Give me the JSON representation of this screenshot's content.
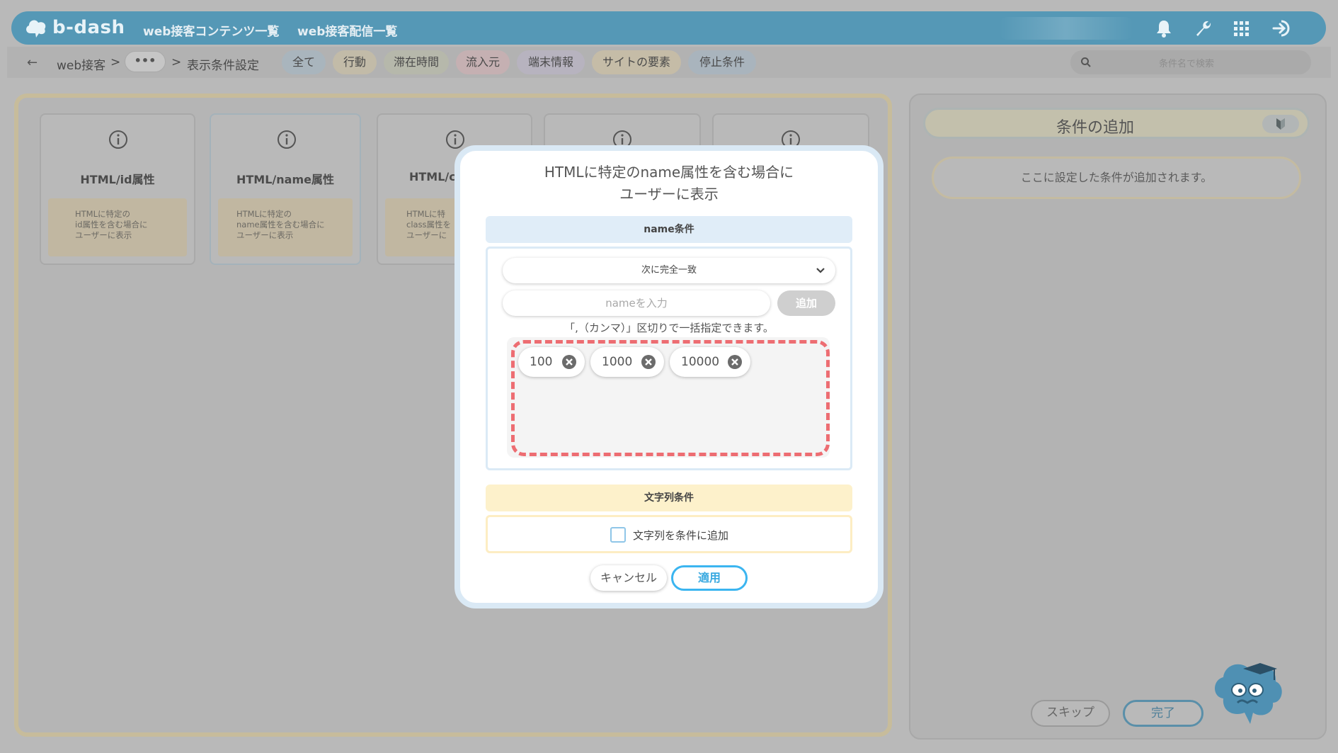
{
  "header": {
    "logo_text": "b-dash",
    "nav": [
      {
        "label": "web接客コンテンツ一覧"
      },
      {
        "label": "web接客配信一覧"
      }
    ],
    "icons": [
      "bell-icon",
      "wrench-icon",
      "grid-icon",
      "logout-icon"
    ]
  },
  "breadcrumb": {
    "back_icon": "←",
    "root": "web接客",
    "sep1": ">",
    "ellipsis": "•••",
    "sep2": ">",
    "current": "表示条件設定"
  },
  "filters": [
    {
      "label": "全て",
      "color": "#a9b5bd"
    },
    {
      "label": "行動",
      "color": "#c2bba8"
    },
    {
      "label": "滞在時間",
      "color": "#b6b8ab"
    },
    {
      "label": "流入元",
      "color": "#c5b0b2"
    },
    {
      "label": "端末情報",
      "color": "#b7b3bf"
    },
    {
      "label": "サイトの要素",
      "color": "#c5bca7"
    },
    {
      "label": "停止条件",
      "color": "#a9b4bd"
    }
  ],
  "search": {
    "placeholder": "条件名で検索"
  },
  "cards": [
    {
      "title": "HTML/id属性",
      "desc": [
        "HTMLに特定の",
        "id属性を含む場合に",
        "ユーザーに表示"
      ]
    },
    {
      "title": "HTML/name属性",
      "desc": [
        "HTMLに特定の",
        "name属性を含む場合に",
        "ユーザーに表示"
      ]
    },
    {
      "title": "HTML/c",
      "desc": [
        "HTMLに特",
        "class属性を",
        "ユーザーに"
      ]
    },
    {
      "title": "",
      "desc": []
    },
    {
      "title": "",
      "desc": []
    }
  ],
  "right_panel": {
    "title": "条件の追加",
    "placeholder": "ここに設定した条件が追加されます。",
    "skip_label": "スキップ",
    "done_label": "完了"
  },
  "modal": {
    "title_line1": "HTMLに特定のname属性を含む場合に",
    "title_line2": "ユーザーに表示",
    "name_section": "name条件",
    "match_select": "次に完全一致",
    "name_placeholder": "nameを入力",
    "add_label": "追加",
    "hint": "「,（カンマ）」区切りで一括指定できます。",
    "tags": [
      "100",
      "1000",
      "10000"
    ],
    "string_section": "文字列条件",
    "string_checkbox_label": "文字列を条件に追加",
    "string_checkbox_checked": false,
    "cancel_label": "キャンセル",
    "apply_label": "適用"
  },
  "colors": {
    "accent": "#3bb5f0",
    "name_section_bg": "#e0edf8",
    "string_section_bg": "#fdf1cb",
    "dash_red": "#ed6d72"
  }
}
